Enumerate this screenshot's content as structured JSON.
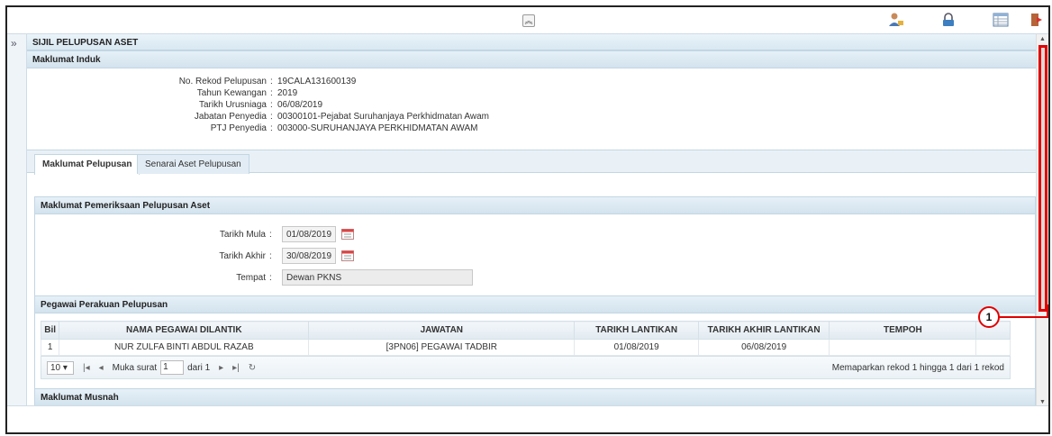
{
  "toolbar": {
    "collapse_icon": "double-chevron-up-icon",
    "icons": [
      "user-profile-icon",
      "lock-icon",
      "grid-table-icon",
      "logout-icon"
    ]
  },
  "left": {
    "expand_icon": "double-chevron-right-icon",
    "expand_glyph": "»"
  },
  "page": {
    "title": "SIJIL PELUPUSAN ASET",
    "induk": {
      "header": "Maklumat Induk",
      "rows": [
        {
          "label": "No. Rekod Pelupusan",
          "value": "19CALA131600139"
        },
        {
          "label": "Tahun Kewangan",
          "value": "2019"
        },
        {
          "label": "Tarikh Urusniaga",
          "value": "06/08/2019"
        },
        {
          "label": "Jabatan Penyedia",
          "value": "00300101-Pejabat Suruhanjaya Perkhidmatan Awam"
        },
        {
          "label": "PTJ Penyedia",
          "value": "003000-SURUHANJAYA PERKHIDMATAN AWAM"
        }
      ]
    },
    "tabs": [
      {
        "label": "Maklumat Pelupusan",
        "active": true
      },
      {
        "label": "Senarai Aset Pelupusan",
        "active": false
      }
    ],
    "pemeriksaan": {
      "header": "Maklumat Pemeriksaan Pelupusan Aset",
      "tarikh_mula_label": "Tarikh Mula",
      "tarikh_mula_value": "01/08/2019",
      "tarikh_akhir_label": "Tarikh Akhir",
      "tarikh_akhir_value": "30/08/2019",
      "tempat_label": "Tempat",
      "tempat_value": "Dewan PKNS"
    },
    "pegawai": {
      "header": "Pegawai Perakuan Pelupusan",
      "columns": [
        "Bil",
        "NAMA PEGAWAI DILANTIK",
        "JAWATAN",
        "TARIKH LANTIKAN",
        "TARIKH AKHIR LANTIKAN",
        "TEMPOH"
      ],
      "rows": [
        {
          "bil": "1",
          "nama": "NUR ZULFA BINTI ABDUL RAZAB",
          "jawatan": "[3PN06] PEGAWAI TADBIR",
          "tarikh": "01/08/2019",
          "tarikh_akhir": "06/08/2019",
          "tempoh": ""
        }
      ],
      "pager": {
        "page_size": "10",
        "muka_surat_label": "Muka surat",
        "page_value": "1",
        "dari_label": "dari 1",
        "info": "Memaparkan rekod 1 hingga 1 dari 1 rekod"
      }
    },
    "musnah_header": "Maklumat Musnah"
  },
  "callout": {
    "label": "1",
    "color": "#e00000"
  }
}
